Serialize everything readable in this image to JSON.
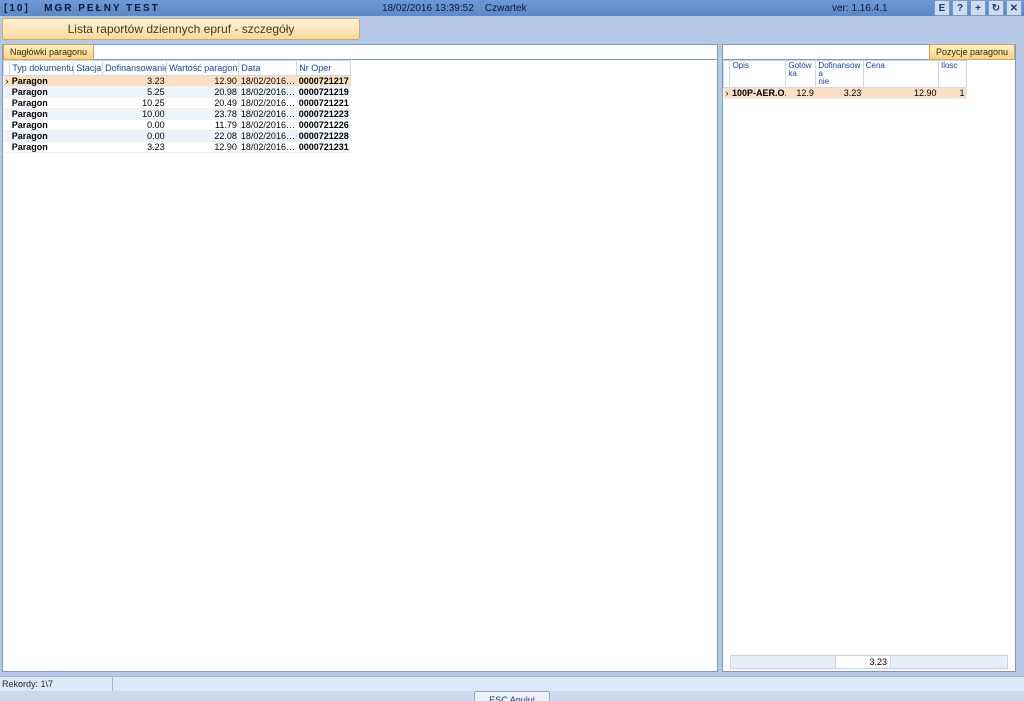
{
  "titlebar": {
    "left_code": "[10]",
    "app_name": "MGR PEŁNY TEST",
    "datetime": "18/02/2016 13:39:52",
    "weekday": "Czwartek",
    "version_label": "ver: 1.16.4.1",
    "icons": [
      "E",
      "?",
      "+",
      "↻",
      "✕"
    ]
  },
  "header_tab": "Lista raportów dziennych epruf - szczegóły",
  "left_panel": {
    "tab": "Nagłówki paragonu",
    "columns": [
      "Typ dokumentu",
      "Stacja",
      "Dofinansowanie",
      "Wartość paragonu",
      "Data",
      "Nr Oper"
    ],
    "rows": [
      {
        "typ": "Paragon",
        "stacja": "",
        "dofin": "3.23",
        "wartosc": "12.90",
        "data": "18/02/2016…",
        "nr": "0000721217",
        "selected": true
      },
      {
        "typ": "Paragon",
        "stacja": "",
        "dofin": "5.25",
        "wartosc": "20.98",
        "data": "18/02/2016…",
        "nr": "0000721219"
      },
      {
        "typ": "Paragon",
        "stacja": "",
        "dofin": "10.25",
        "wartosc": "20.49",
        "data": "18/02/2016…",
        "nr": "0000721221"
      },
      {
        "typ": "Paragon",
        "stacja": "",
        "dofin": "10.00",
        "wartosc": "23.78",
        "data": "18/02/2016…",
        "nr": "0000721223"
      },
      {
        "typ": "Paragon",
        "stacja": "",
        "dofin": "0.00",
        "wartosc": "11.79",
        "data": "18/02/2016…",
        "nr": "0000721226"
      },
      {
        "typ": "Paragon",
        "stacja": "",
        "dofin": "0.00",
        "wartosc": "22.08",
        "data": "18/02/2016…",
        "nr": "0000721228"
      },
      {
        "typ": "Paragon",
        "stacja": "",
        "dofin": "3.23",
        "wartosc": "12.90",
        "data": "18/02/2016…",
        "nr": "0000721231"
      }
    ]
  },
  "right_panel": {
    "tab": "Pozycje paragonu",
    "columns": [
      "Opis",
      "Gotówka",
      "Dofinansowanie",
      "Cena",
      "Ilosc"
    ],
    "columns_display": [
      "Opis",
      "Gotów\nka",
      "Dofinansowa\nnie",
      "Cena",
      "Ilosc"
    ],
    "rows": [
      {
        "opis": "100P-AER.O…",
        "gotowka": "12.9",
        "dofin": "3.23",
        "cena": "12.90",
        "ilosc": "1"
      }
    ],
    "summary_value": "3.23"
  },
  "statusbar": {
    "records": "Rekordy: 1\\7"
  },
  "buttons": {
    "esc": "ESC Anuluj"
  }
}
